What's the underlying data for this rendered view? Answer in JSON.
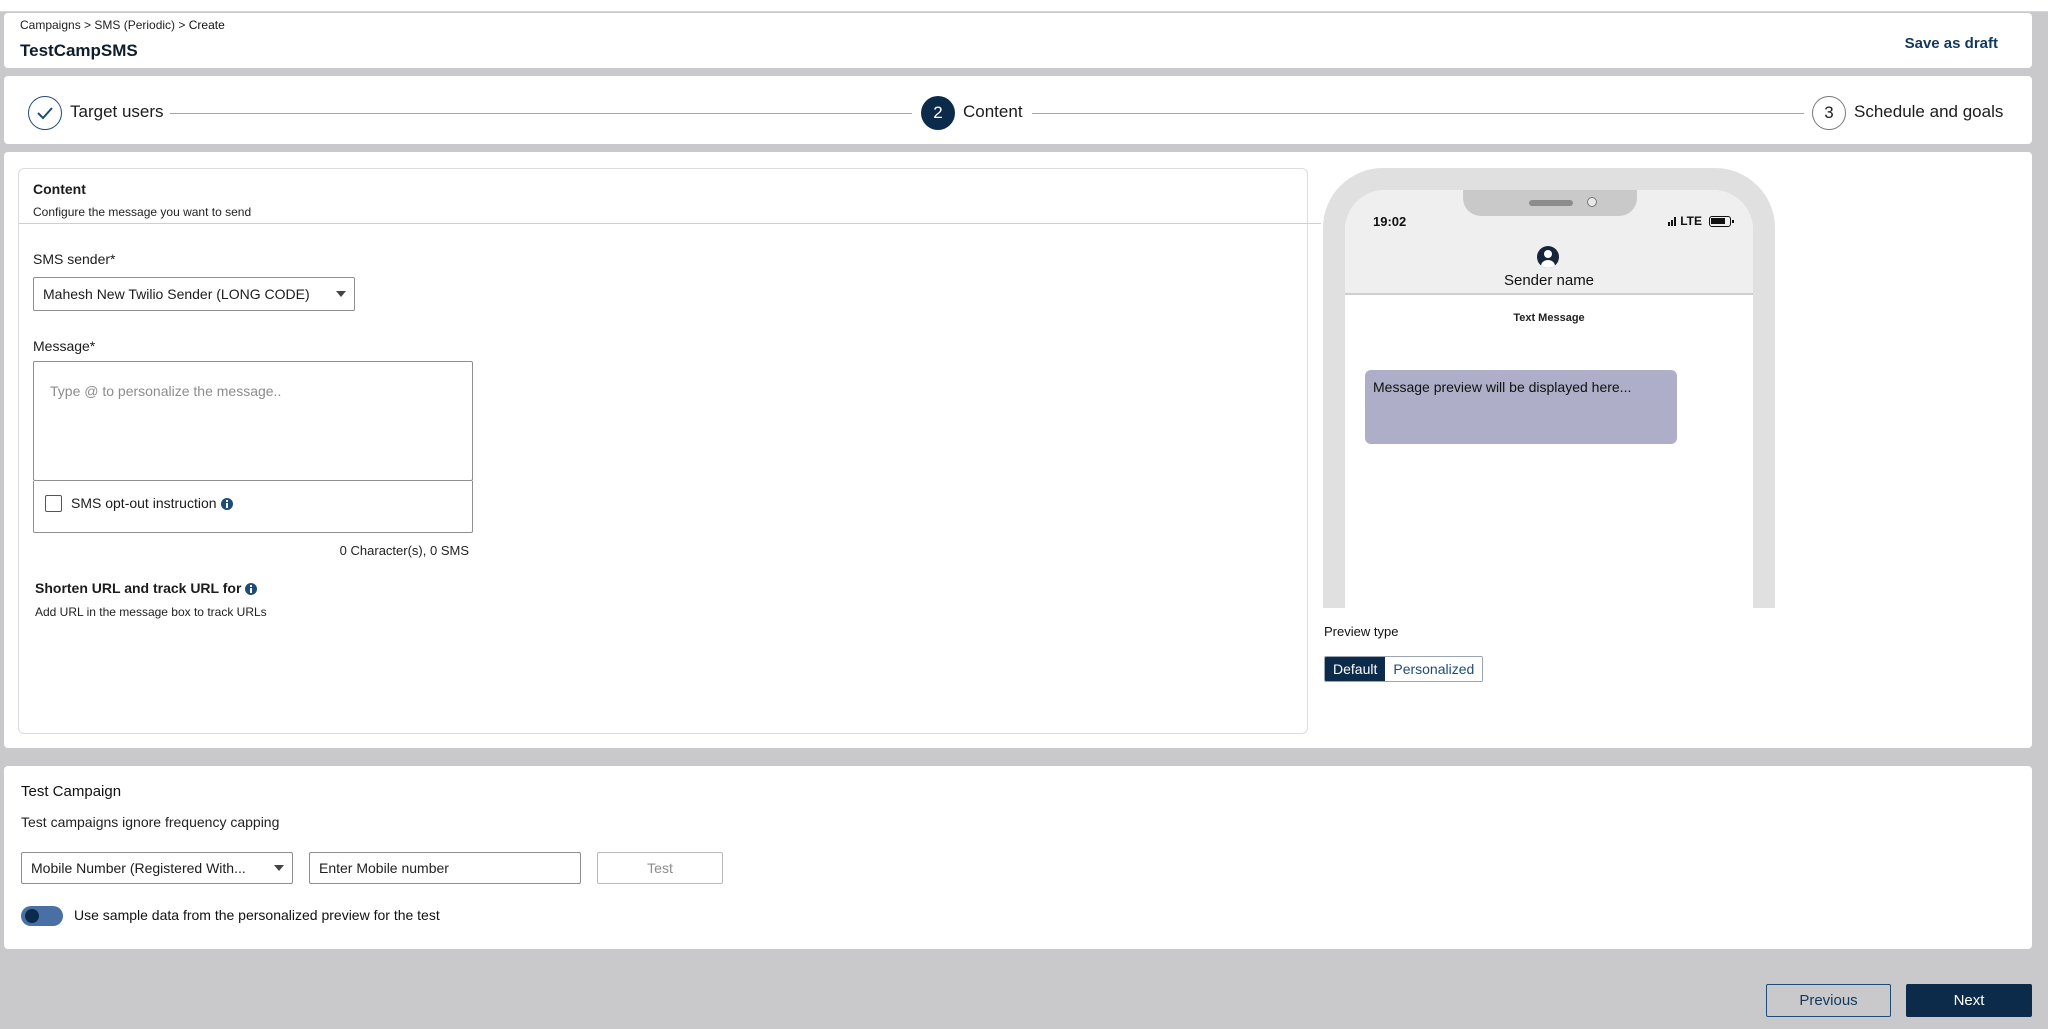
{
  "breadcrumb": {
    "path": "Campaigns > SMS (Periodic) > ",
    "current": "Create"
  },
  "header": {
    "title": "TestCampSMS",
    "save_draft": "Save as draft"
  },
  "stepper": {
    "steps": [
      {
        "number": "",
        "label": "Target users",
        "state": "done"
      },
      {
        "number": "2",
        "label": "Content",
        "state": "active"
      },
      {
        "number": "3",
        "label": "Schedule and goals",
        "state": "todo"
      }
    ]
  },
  "content": {
    "title": "Content",
    "subtitle": "Configure the message you want to send",
    "sender_label": "SMS sender*",
    "sender_value": "Mahesh New Twilio Sender (LONG CODE)",
    "message_label": "Message*",
    "message_placeholder": "Type @ to personalize the message..",
    "optout_label": "SMS opt-out instruction",
    "char_count": "0 Character(s), 0 SMS",
    "shorten_title": "Shorten URL and track URL for",
    "shorten_sub": "Add URL in the message box to track URLs"
  },
  "phone": {
    "time": "19:02",
    "network": "LTE",
    "sender_name": "Sender name",
    "text_message_label": "Text Message",
    "bubble_text": "Message preview will be displayed here..."
  },
  "preview": {
    "label": "Preview type",
    "options": [
      "Default",
      "Personalized"
    ],
    "selected": "Default"
  },
  "test_campaign": {
    "title": "Test Campaign",
    "subtitle": "Test campaigns ignore frequency capping",
    "type_value": "Mobile Number (Registered With...",
    "mobile_placeholder": "Enter Mobile number",
    "test_button": "Test",
    "toggle_label": "Use sample data from the personalized preview for the test",
    "toggle_on": true
  },
  "footer": {
    "previous": "Previous",
    "next": "Next"
  },
  "colors": {
    "primary": "#0c2b4b",
    "link": "#103a5c",
    "bubble": "#aeaec8",
    "background": "#c9c9cb"
  }
}
